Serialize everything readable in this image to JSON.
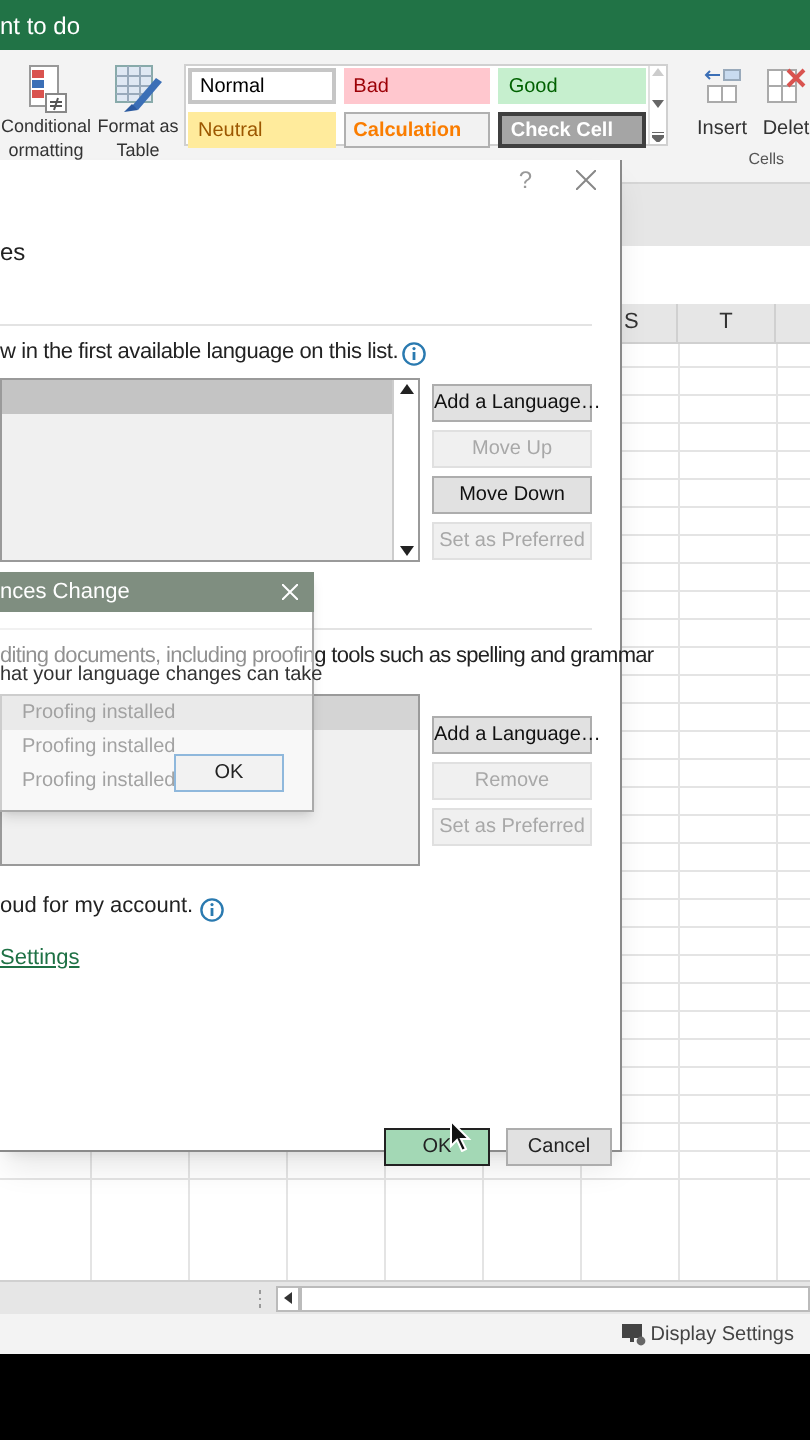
{
  "title_bar": {
    "title": "nt to do"
  },
  "ribbon": {
    "commands": [
      {
        "lines": [
          "Conditional",
          "ormatting"
        ],
        "kind": "conditional"
      },
      {
        "lines": [
          "Format as",
          "Table"
        ],
        "kind": "table"
      }
    ],
    "cell_styles": [
      {
        "label": "Normal",
        "kind": "normal"
      },
      {
        "label": "Bad",
        "kind": "bad"
      },
      {
        "label": "Good",
        "kind": "good"
      },
      {
        "label": "Neutral",
        "kind": "neutral"
      },
      {
        "label": "Calculation",
        "kind": "calculation"
      },
      {
        "label": "Check Cell",
        "kind": "check"
      }
    ],
    "cells_commands": [
      {
        "label": "Insert",
        "kind": "insert"
      },
      {
        "label": "Delet",
        "kind": "delete"
      }
    ],
    "cells_group": "Cells"
  },
  "columns": [
    "S",
    "T"
  ],
  "dialog": {
    "help": "?",
    "display_language": {
      "heading": "es",
      "instruction": "w in the first available language on this list.",
      "rows": [
        {
          "selected": true
        }
      ],
      "buttons": [
        {
          "label": "Add a Language…",
          "disabled": false
        },
        {
          "label": "Move Up",
          "disabled": true
        },
        {
          "label": "Move Down",
          "disabled": false
        },
        {
          "label": "Set as Preferred",
          "disabled": true
        }
      ]
    },
    "editing_language": {
      "instruction": "diting documents, including proofing tools such as spelling and grammar",
      "rows": [
        {
          "status": "Proofing installed",
          "selected": true
        },
        {
          "status": "Proofing installed",
          "selected": false
        },
        {
          "status": "Proofing installed",
          "selected": false
        }
      ],
      "buttons": [
        {
          "label": "Add a Language…",
          "disabled": false
        },
        {
          "label": "Remove",
          "disabled": true
        },
        {
          "label": "Set as Preferred",
          "disabled": true
        }
      ]
    },
    "cloud_text": "oud for my account.",
    "link": "Settings",
    "footer_buttons": [
      {
        "label": "OK",
        "highlighted": true
      },
      {
        "label": "Cancel",
        "highlighted": false
      }
    ]
  },
  "sub_dialog": {
    "title": "nces Change",
    "message": "hat your language changes can take",
    "button": "OK"
  },
  "status_bar": {
    "display_settings": "Display Settings"
  }
}
